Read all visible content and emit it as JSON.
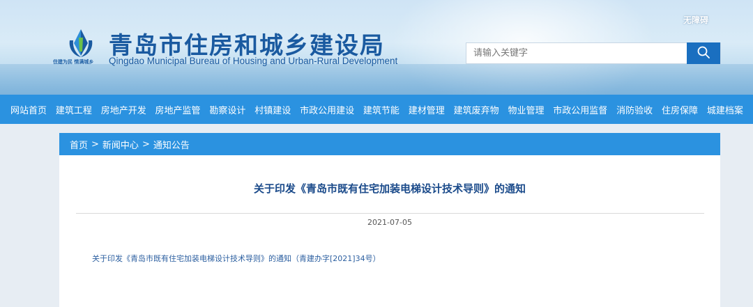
{
  "header": {
    "accessibility_label": "无障碍",
    "logo": {
      "name_cn": "青岛市住房和城乡建设局",
      "name_en": "Qingdao Municipal Bureau of Housing and Urban-Rural Development",
      "slogan": "住建为民 情满城乡",
      "icon": "qingdao-housing-bureau-logo-icon"
    },
    "search": {
      "placeholder": "请输入关键字",
      "value": "",
      "button_icon": "search-icon"
    }
  },
  "nav": {
    "items": [
      {
        "label": "网站首页"
      },
      {
        "label": "建筑工程"
      },
      {
        "label": "房地产开发"
      },
      {
        "label": "房地产监管"
      },
      {
        "label": "勘察设计"
      },
      {
        "label": "村镇建设"
      },
      {
        "label": "市政公用建设"
      },
      {
        "label": "建筑节能"
      },
      {
        "label": "建材管理"
      },
      {
        "label": "建筑废弃物"
      },
      {
        "label": "物业管理"
      },
      {
        "label": "市政公用监督"
      },
      {
        "label": "消防验收"
      },
      {
        "label": "住房保障"
      },
      {
        "label": "城建档案"
      }
    ]
  },
  "breadcrumb": {
    "items": [
      "首页",
      "新闻中心",
      "通知公告"
    ],
    "separator": ">"
  },
  "article": {
    "title": "关于印发《青岛市既有住宅加装电梯设计技术导则》的通知",
    "date": "2021-07-05",
    "attachment_link": "关于印发《青岛市既有住宅加装电梯设计技术导则》的通知（青建办字[2021]34号）"
  },
  "colors": {
    "brand_blue": "#1a5aa0",
    "nav_blue": "#2b92e0",
    "search_button": "#1a6fc0",
    "title_text": "#1a4a8a"
  }
}
